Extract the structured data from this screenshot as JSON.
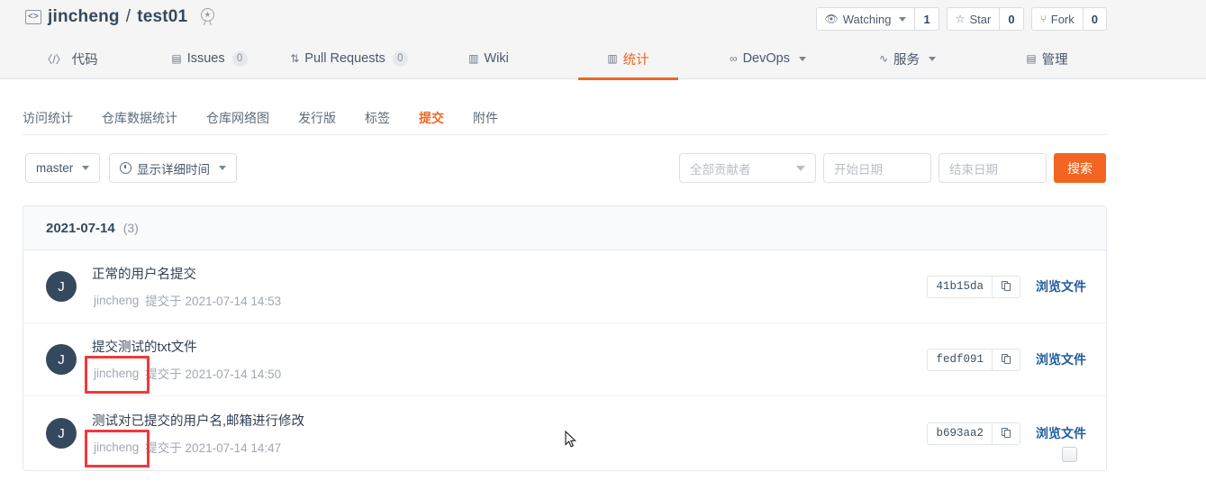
{
  "header": {
    "repo_owner": "jincheng",
    "separator": "/",
    "repo_name": "test01",
    "code_icon_glyph": "<>",
    "badge_icon": "award-badge-icon",
    "watch_label": "Watching",
    "watch_count": "1",
    "star_label": "Star",
    "star_count": "0",
    "fork_label": "Fork",
    "fork_count": "0"
  },
  "main_nav": [
    {
      "label": "代码",
      "icon": "code-icon",
      "icon_glyph": "〈/〉",
      "count": null,
      "active": false,
      "dropdown": false
    },
    {
      "label": "Issues",
      "icon": "issue-icon",
      "icon_glyph": "▤",
      "count": "0",
      "active": false,
      "dropdown": false
    },
    {
      "label": "Pull Requests",
      "icon": "pull-request-icon",
      "icon_glyph": "⇅",
      "count": "0",
      "active": false,
      "dropdown": false
    },
    {
      "label": "Wiki",
      "icon": "wiki-book-icon",
      "icon_glyph": "▥",
      "count": null,
      "active": false,
      "dropdown": false
    },
    {
      "label": "统计",
      "icon": "chart-bar-icon",
      "icon_glyph": "▥",
      "count": null,
      "active": true,
      "dropdown": false
    },
    {
      "label": "DevOps",
      "icon": "infinity-icon",
      "icon_glyph": "∞",
      "count": null,
      "active": false,
      "dropdown": true
    },
    {
      "label": "服务",
      "icon": "pulse-icon",
      "icon_glyph": "∿",
      "count": null,
      "active": false,
      "dropdown": true
    },
    {
      "label": "管理",
      "icon": "settings-doc-icon",
      "icon_glyph": "▤",
      "count": null,
      "active": false,
      "dropdown": false
    }
  ],
  "sub_nav": [
    {
      "label": "访问统计",
      "active": false
    },
    {
      "label": "仓库数据统计",
      "active": false
    },
    {
      "label": "仓库网络图",
      "active": false
    },
    {
      "label": "发行版",
      "active": false
    },
    {
      "label": "标签",
      "active": false
    },
    {
      "label": "提交",
      "active": true
    },
    {
      "label": "附件",
      "active": false
    }
  ],
  "filters": {
    "branch_label": "master",
    "time_format_label": "显示详细时间",
    "contributor_placeholder": "全部贡献者",
    "start_date_placeholder": "开始日期",
    "end_date_placeholder": "结束日期",
    "search_button": "搜索",
    "accent_color": "#f26522"
  },
  "commits_card": {
    "date": "2021-07-14",
    "count": "(3)",
    "browse_label": "浏览文件",
    "rows": [
      {
        "avatar_initial": "J",
        "title": "正常的用户名提交",
        "author": "jincheng",
        "meta_suffix": "提交于 2021-07-14 14:53",
        "sha": "41b15da",
        "highlighted": false
      },
      {
        "avatar_initial": "J",
        "title": "提交测试的txt文件",
        "author": "jincheng",
        "meta_suffix": "提交于 2021-07-14 14:50",
        "sha": "fedf091",
        "highlighted": true
      },
      {
        "avatar_initial": "J",
        "title": "测试对已提交的用户名,邮箱进行修改",
        "author": "jincheng",
        "meta_suffix": "提交于 2021-07-14 14:47",
        "sha": "b693aa2",
        "highlighted": true
      }
    ]
  },
  "annotation": {
    "highlight_color": "#f2383a"
  }
}
